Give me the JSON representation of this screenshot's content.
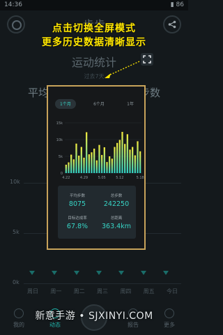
{
  "status_bar": {
    "time": "14:36",
    "battery": "86"
  },
  "header": {
    "title": "步步",
    "subtitle": "运动统计",
    "period_hint": "过去7天"
  },
  "background": {
    "left_label": "平均",
    "right_label": "步数",
    "axis": [
      "10k",
      "5k",
      "0k"
    ],
    "days": [
      "周日",
      "周一",
      "周二",
      "周三",
      "周四",
      "周五",
      "今日"
    ]
  },
  "banner": {
    "line1": "点击切换全屏模式",
    "line2": "更多历史数据清晰显示"
  },
  "popup": {
    "tabs": [
      {
        "label": "1个月",
        "active": true
      },
      {
        "label": "6个月",
        "active": false
      },
      {
        "label": "1年",
        "active": false
      }
    ],
    "stats": [
      {
        "label": "平均步数",
        "value": "8075"
      },
      {
        "label": "总步数",
        "value": "242250"
      },
      {
        "label": "目标达成率",
        "value": "67.8%"
      },
      {
        "label": "总距离",
        "value": "363.4km"
      }
    ]
  },
  "chart_data": {
    "type": "bar",
    "x_ticks": [
      "4.22",
      "4.29",
      "5.05",
      "5.12",
      "5.18"
    ],
    "y_ticks": [
      "0",
      "5k",
      "10k",
      "15k"
    ],
    "ylim": [
      0,
      15000
    ],
    "values": [
      2500,
      3200,
      5500,
      4100,
      8800,
      5200,
      7800,
      4600,
      12200,
      5600,
      6200,
      7300,
      3800,
      8400,
      5400,
      7700,
      3300,
      5000,
      4300,
      7800,
      9000,
      9900,
      12300,
      8700,
      11600,
      7000,
      7800,
      5300,
      9500,
      6500
    ]
  },
  "tabbar": {
    "items": [
      "我的",
      "动态",
      "",
      "报告",
      "更多"
    ]
  },
  "watermark": "新意手游 • SJXINYI.COM",
  "colors": {
    "accent": "#1fb3a9",
    "banner": "#ffe600",
    "popup_border": "#c8a35a"
  }
}
